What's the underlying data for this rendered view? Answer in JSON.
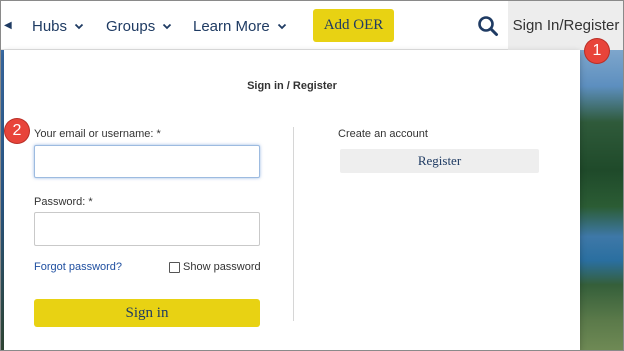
{
  "nav": {
    "items": [
      {
        "label": "Hubs"
      },
      {
        "label": "Groups"
      },
      {
        "label": "Learn More"
      }
    ],
    "add_oer_label": "Add OER",
    "signin_tab_label": "Sign In/Register",
    "search_icon": "search-icon",
    "chevron_icon": "chevron-down-icon"
  },
  "panel": {
    "title": "Sign in / Register",
    "email_label": "Your email or username: *",
    "email_value": "",
    "password_label": "Password: *",
    "password_value": "",
    "forgot_label": "Forgot password?",
    "show_password_label": "Show password",
    "show_password_checked": false,
    "signin_label": "Sign in",
    "create_account_label": "Create an account",
    "register_label": "Register"
  },
  "callouts": {
    "first": "1",
    "second": "2"
  },
  "colors": {
    "accent_yellow": "#e8d213",
    "nav_text": "#1f3b63",
    "badge_red": "#e8443a",
    "link_blue": "#1f4fa0"
  }
}
